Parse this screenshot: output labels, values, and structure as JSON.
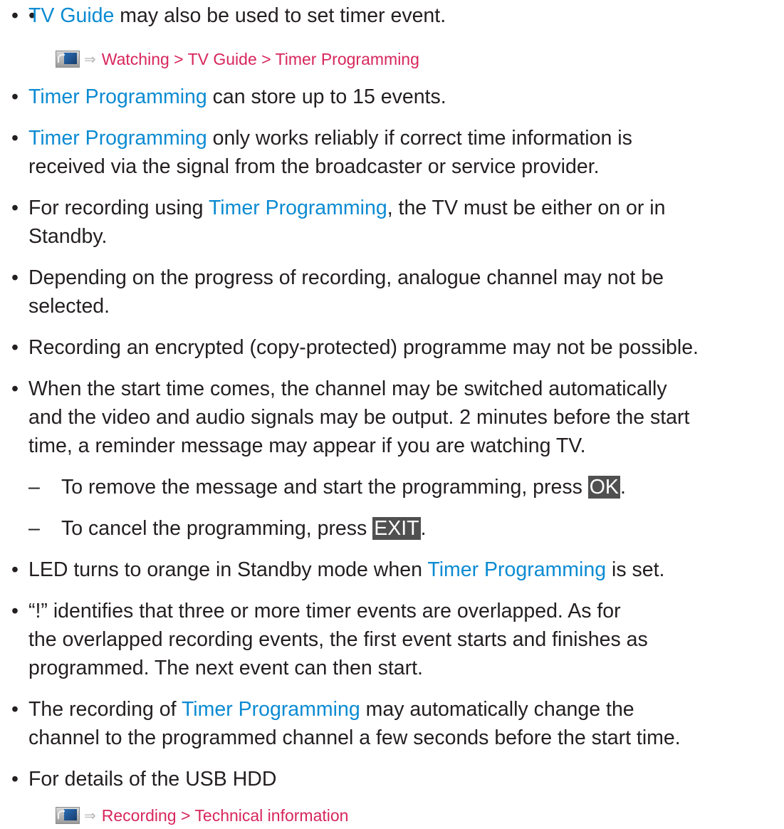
{
  "bullet_symbol": "•",
  "dash_symbol": "–",
  "arrow_symbol": "⇒",
  "items": [
    {
      "link": "TV Guide",
      "rest": " may also be used to set timer event."
    },
    {
      "link": "Timer Programming",
      "rest": " can store up to 15 events."
    },
    {
      "link": "Timer Programming",
      "rest": " only works reliably if correct time information is",
      "line2": "received via the signal from the broadcaster or service provider."
    },
    {
      "pre": "For recording using ",
      "link": "Timer Programming",
      "rest": ", the TV must be either on or in",
      "line2": "Standby."
    },
    {
      "text": "Depending on the progress of recording, analogue channel may not be",
      "line2": "selected."
    },
    {
      "text": "Recording an encrypted (copy-protected) programme may not be possible."
    },
    {
      "text": "When the start time comes, the channel may be switched automatically",
      "line2": "and the video and audio signals may be output. 2 minutes before the start",
      "line3": "time, a reminder message may appear if you are watching TV."
    },
    {
      "pre": "LED turns to orange in Standby mode when ",
      "link": "Timer Programming",
      "rest": " is set."
    },
    {
      "text": "“!” identifies that three or more timer events are overlapped. As for",
      "line2": "the overlapped recording events, the first event starts and finishes as",
      "line3": "programmed. The next event can then start."
    },
    {
      "pre": "The recording of ",
      "link": "Timer Programming",
      "rest": " may automatically change the",
      "line2": "channel to the programmed channel a few seconds before the start time."
    },
    {
      "text": "For details of the USB HDD"
    }
  ],
  "subitems": [
    {
      "text": "To remove the message and start the programming, press ",
      "key": "OK",
      "end": "."
    },
    {
      "text": "To cancel the programming, press ",
      "key": "EXIT",
      "end": "."
    }
  ],
  "crumbs": [
    {
      "icon": "tv-menu-icon",
      "path": "Watching > TV Guide > Timer Programming"
    },
    {
      "icon": "tv-menu-icon",
      "path": "Recording > Technical information"
    }
  ]
}
